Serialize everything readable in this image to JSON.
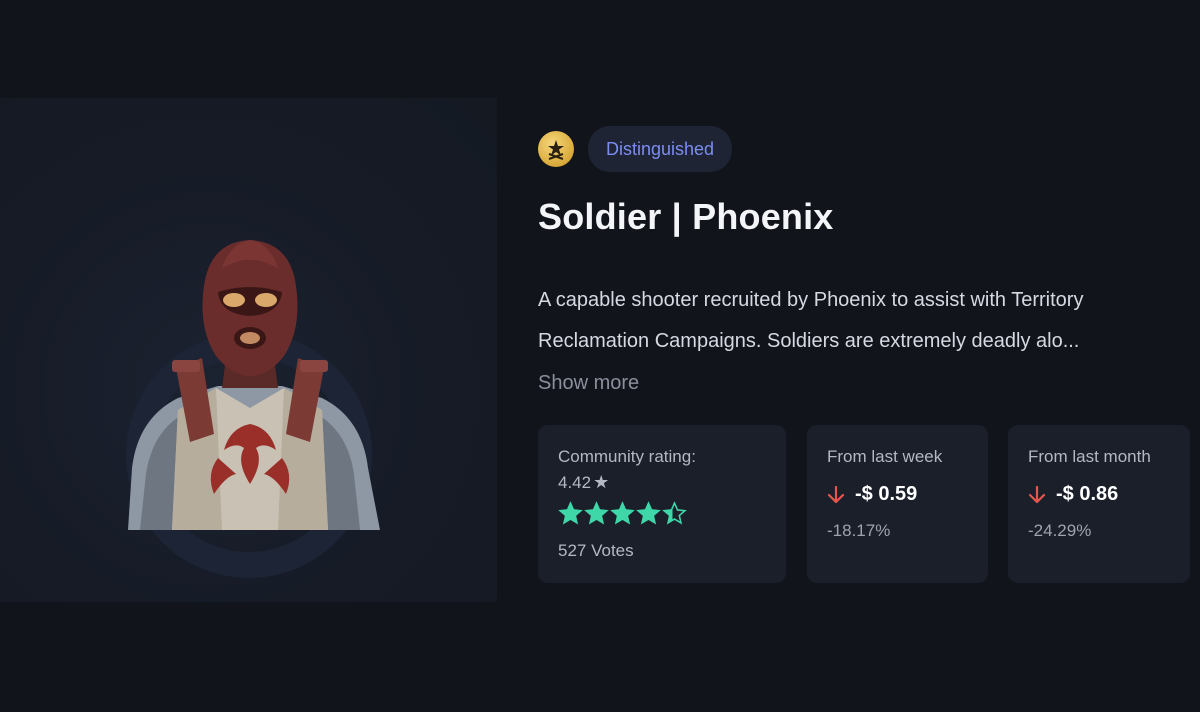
{
  "item": {
    "rarity": "Distinguished",
    "rarity_color": "#7b8cf0",
    "rank_icon": "gold-rank-icon",
    "name": "Soldier | Phoenix",
    "description": "A capable shooter recruited by Phoenix to assist with Territory Reclamation Campaigns. Soldiers are extremely deadly alo...",
    "show_more_label": "Show more"
  },
  "rating": {
    "label": "Community rating:",
    "value": "4.42",
    "stars_filled": 4.42,
    "stars_total": 5,
    "votes": "527 Votes",
    "star_color": "#3fd6a8"
  },
  "week": {
    "label": "From last week",
    "change": "-$ 0.59",
    "percent": "-18.17%",
    "direction": "down",
    "arrow_color": "#e8554e"
  },
  "month": {
    "label": "From last month",
    "change": "-$ 0.86",
    "percent": "-24.29%",
    "direction": "down",
    "arrow_color": "#e8554e"
  }
}
